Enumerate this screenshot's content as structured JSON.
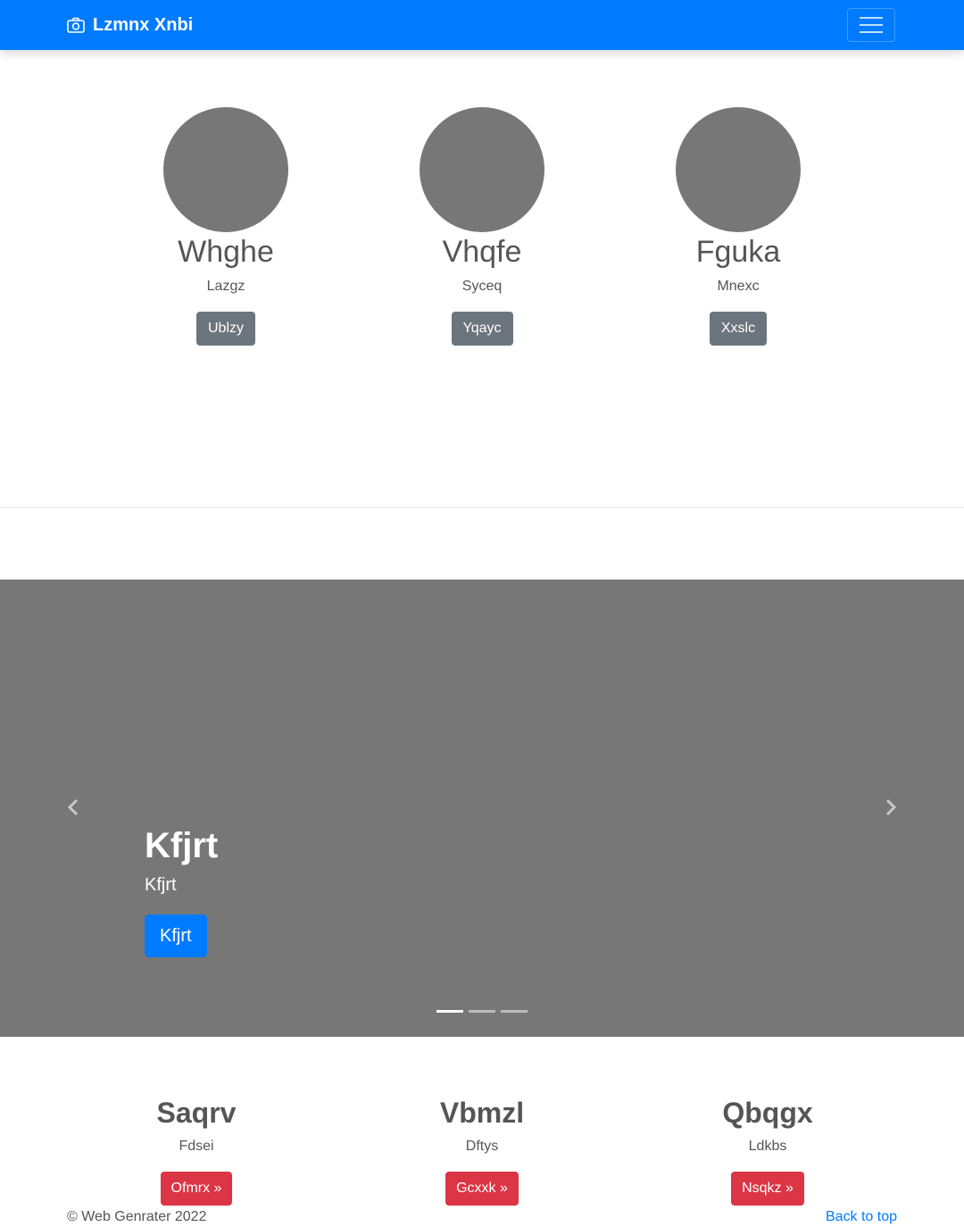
{
  "navbar": {
    "brand": "Lzmnx Xnbi",
    "brand_icon": "camera-icon",
    "toggler_icon": "hamburger-icon",
    "color": "#007bff"
  },
  "profiles": [
    {
      "name": "Whghe",
      "subtitle": "Lazgz",
      "button": "Ublzy"
    },
    {
      "name": "Vhqfe",
      "subtitle": "Syceq",
      "button": "Yqayc"
    },
    {
      "name": "Fguka",
      "subtitle": "Mnexc",
      "button": "Xxslc"
    }
  ],
  "carousel": {
    "title": "Kfjrt",
    "text": "Kfjrt",
    "button": "Kfjrt",
    "prev_icon": "chevron-left-icon",
    "next_icon": "chevron-right-icon",
    "active_slide": 1,
    "slide_count": 3
  },
  "features": [
    {
      "title": "Saqrv",
      "text": "Fdsei",
      "button": "Ofmrx »"
    },
    {
      "title": "Vbmzl",
      "text": "Dftys",
      "button": "Gcxxk »"
    },
    {
      "title": "Qbqgx",
      "text": "Ldkbs",
      "button": "Nsqkz »"
    }
  ],
  "footer": {
    "copyright": "© Web Genrater 2022",
    "back_to_top": "Back to top"
  }
}
